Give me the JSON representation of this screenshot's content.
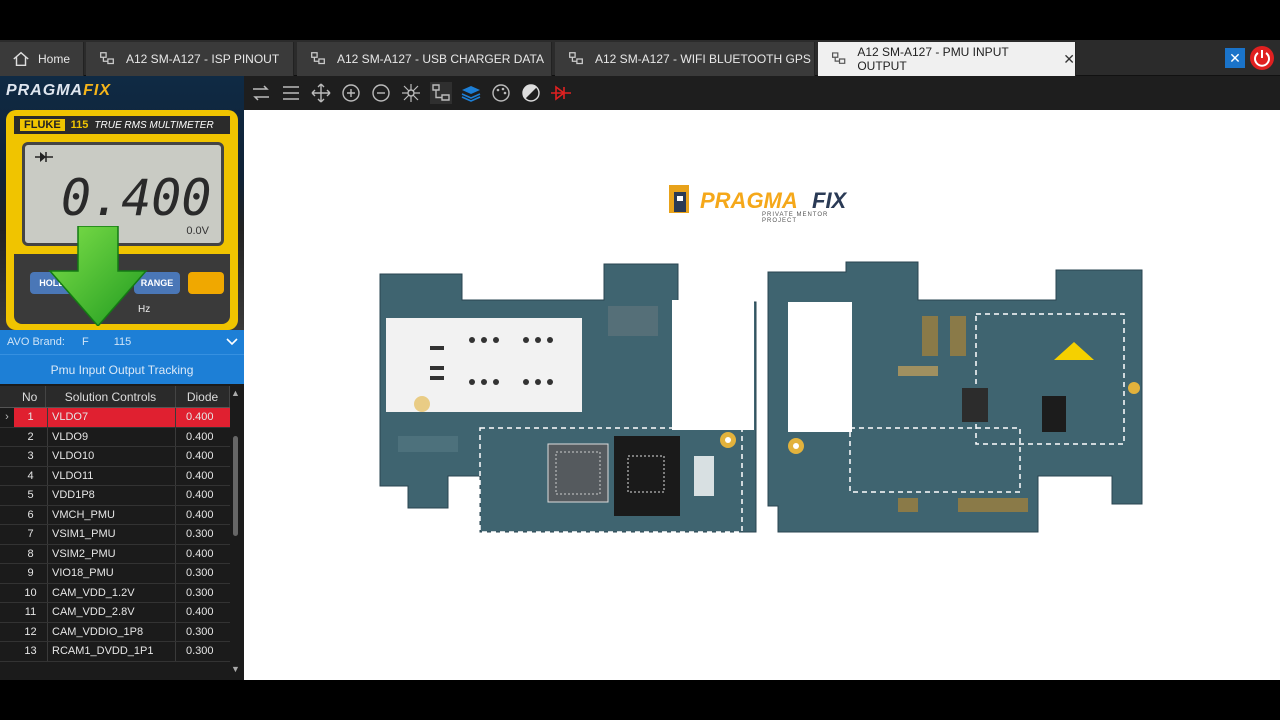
{
  "tabs": {
    "home": "Home",
    "tab1": "A12 SM-A127 - ISP PINOUT",
    "tab2": "A12 SM-A127 - USB CHARGER DATA",
    "tab3": "A12 SM-A127 - WIFI BLUETOOTH GPS",
    "tab4": "A12 SM-A127 - PMU INPUT OUTPUT",
    "close_glyph": "✕"
  },
  "brand": {
    "part1": "PRAGMA",
    "part2": "FIX"
  },
  "multimeter": {
    "brand": "FLUKE",
    "model": "115",
    "model_text": "TRUE RMS MULTIMETER",
    "reading": "0.400",
    "sub_reading": "0.0V",
    "hold": "HOLD",
    "range": "RANGE",
    "hz": "Hz"
  },
  "avo": {
    "label": "AVO Brand:",
    "value": "F",
    "value_tail": "115"
  },
  "tracking_title": "Pmu Input Output Tracking",
  "table": {
    "headers": {
      "no": "No",
      "solution": "Solution Controls",
      "diode": "Diode"
    },
    "rows": [
      {
        "no": "1",
        "name": "VLDO7",
        "diode": "0.400"
      },
      {
        "no": "2",
        "name": "VLDO9",
        "diode": "0.400"
      },
      {
        "no": "3",
        "name": "VLDO10",
        "diode": "0.400"
      },
      {
        "no": "4",
        "name": "VLDO11",
        "diode": "0.400"
      },
      {
        "no": "5",
        "name": "VDD1P8",
        "diode": "0.400"
      },
      {
        "no": "6",
        "name": "VMCH_PMU",
        "diode": "0.400"
      },
      {
        "no": "7",
        "name": "VSIM1_PMU",
        "diode": "0.300"
      },
      {
        "no": "8",
        "name": "VSIM2_PMU",
        "diode": "0.400"
      },
      {
        "no": "9",
        "name": "VIO18_PMU",
        "diode": "0.300"
      },
      {
        "no": "10",
        "name": "CAM_VDD_1.2V",
        "diode": "0.300"
      },
      {
        "no": "11",
        "name": "CAM_VDD_2.8V",
        "diode": "0.400"
      },
      {
        "no": "12",
        "name": "CAM_VDDIO_1P8",
        "diode": "0.300"
      },
      {
        "no": "13",
        "name": "RCAM1_DVDD_1P1",
        "diode": "0.300"
      }
    ]
  },
  "canvas_logo": {
    "main1": "PRAGMA",
    "main2": "FIX",
    "tagline": "PRIVATE MENTOR PROJECT"
  },
  "colors": {
    "accent_blue": "#1d7fd6",
    "selected_red": "#e02030",
    "pcb_teal": "#3f6470",
    "logo_orange": "#f5a81a"
  }
}
